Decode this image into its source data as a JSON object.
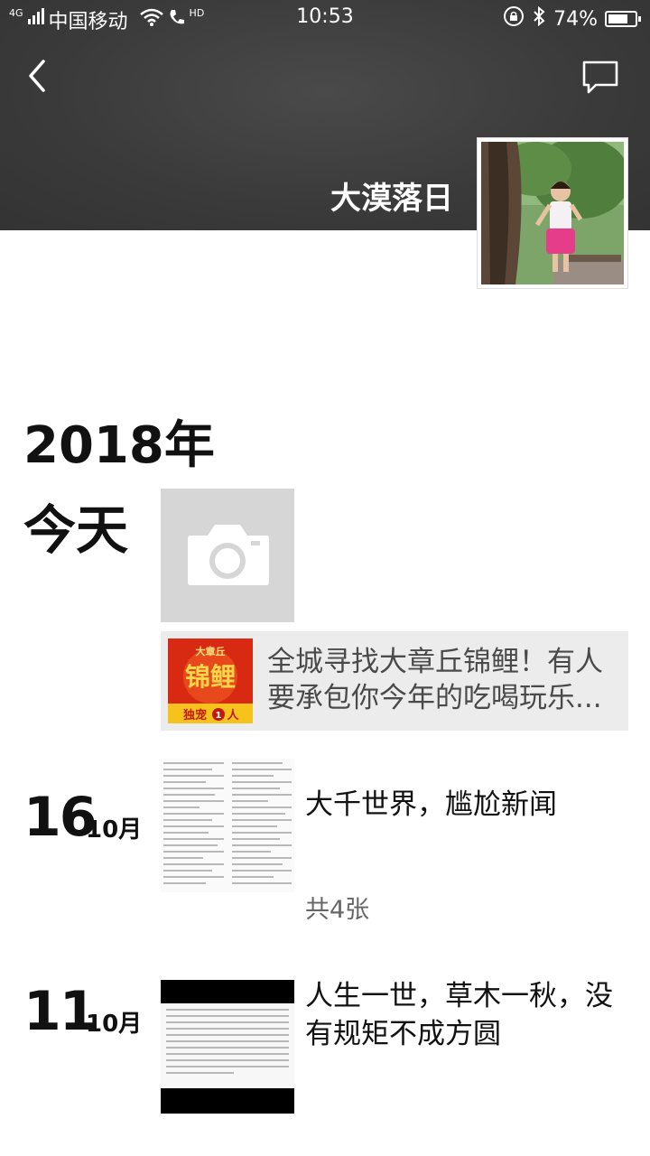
{
  "status_bar": {
    "network": "4G",
    "carrier": "中国移动",
    "hd_label": "HD",
    "time": "10:53",
    "battery_percent": "74%",
    "battery_level": 0.74
  },
  "profile": {
    "username": "大漠落日",
    "avatar_icon": "avatar-photo",
    "cover_color": "#3c3c3c"
  },
  "timeline": {
    "year_label": "2018年",
    "today_label": "今天",
    "share_card": {
      "title": "全城寻找大章丘锦鲤！有人要承包你今年的吃喝玩乐...",
      "thumb_top_text": "大章丘",
      "thumb_big_text": "锦鲤",
      "thumb_bottom_text": "独宠",
      "thumb_num": "1",
      "thumb_tail": "人"
    },
    "posts": [
      {
        "day": "16",
        "month": "10月",
        "text": "大千世界，尴尬新闻",
        "count": "共4张"
      },
      {
        "day": "11",
        "month": "10月",
        "text": "人生一世，草木一秋，没有规矩不成方圆"
      }
    ]
  },
  "colors": {
    "tile_gray": "#d6d6d6",
    "card_gray": "#ececec",
    "share_red": "#d82a12",
    "share_yellow": "#f6c21c"
  }
}
